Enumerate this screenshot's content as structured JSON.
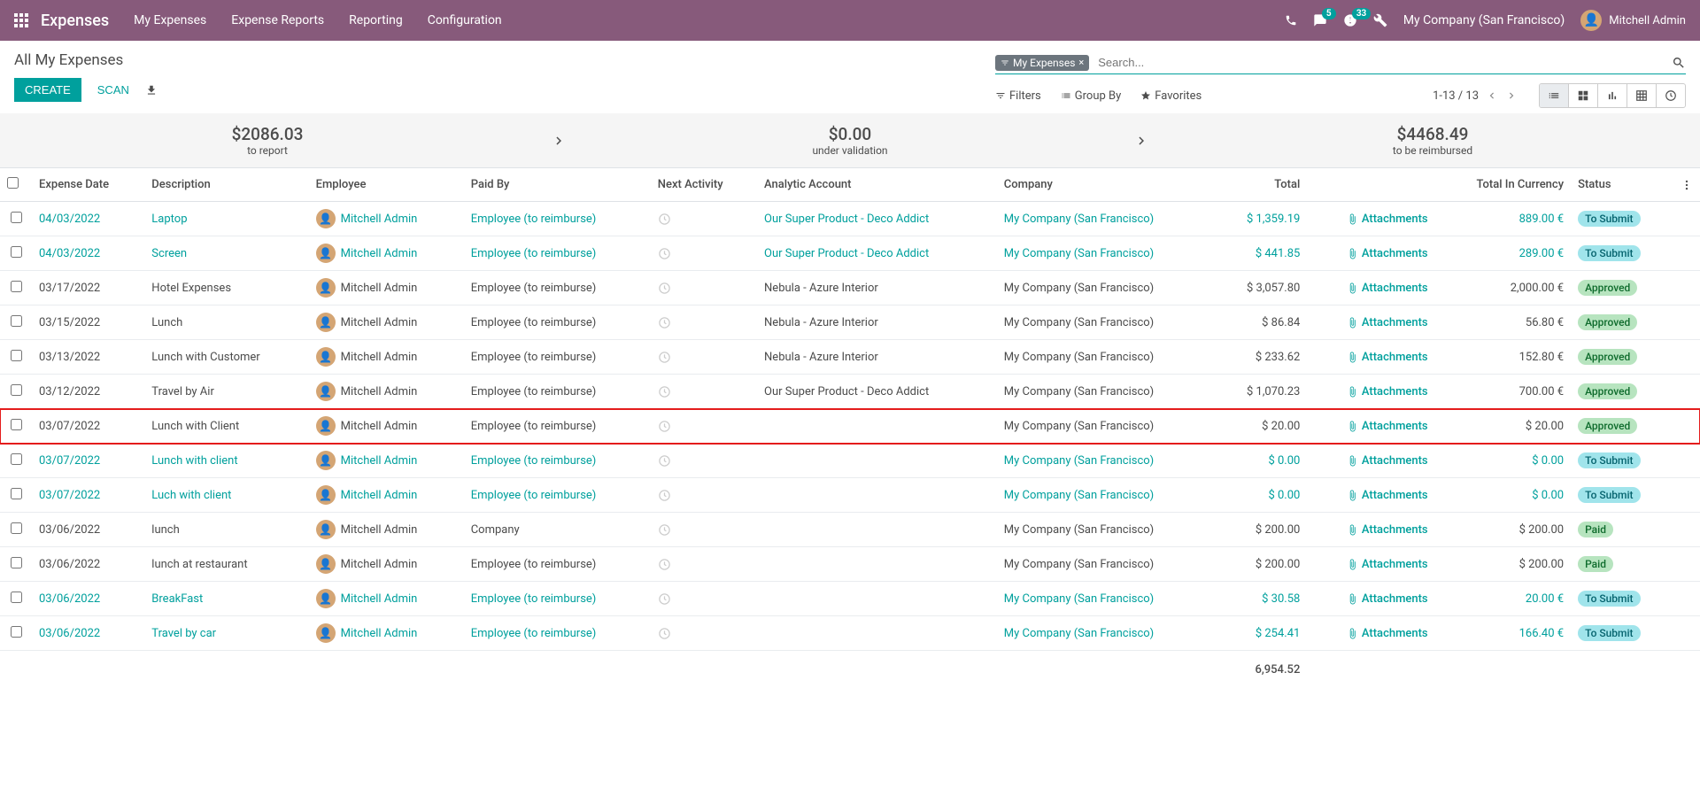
{
  "nav": {
    "brand": "Expenses",
    "items": [
      "My Expenses",
      "Expense Reports",
      "Reporting",
      "Configuration"
    ],
    "badge_chat": "5",
    "badge_activity": "33",
    "company": "My Company (San Francisco)",
    "user": "Mitchell Admin"
  },
  "page": {
    "title": "All My Expenses",
    "btn_create": "CREATE",
    "btn_scan": "SCAN",
    "search_filter_tag": "My Expenses",
    "search_placeholder": "Search...",
    "filters_label": "Filters",
    "groupby_label": "Group By",
    "favorites_label": "Favorites",
    "pager": "1-13 / 13"
  },
  "summary": {
    "to_report_amount": "$2086.03",
    "to_report_label": "to report",
    "under_validation_amount": "$0.00",
    "under_validation_label": "under validation",
    "reimbursed_amount": "$4468.49",
    "reimbursed_label": "to be reimbursed"
  },
  "table": {
    "headers": {
      "date": "Expense Date",
      "description": "Description",
      "employee": "Employee",
      "paid_by": "Paid By",
      "next_activity": "Next Activity",
      "analytic": "Analytic Account",
      "company": "Company",
      "total": "Total",
      "total_currency": "Total In Currency",
      "status": "Status"
    },
    "attachments_label": "Attachments",
    "rows": [
      {
        "date": "04/03/2022",
        "desc": "Laptop",
        "employee": "Mitchell Admin",
        "paid_by": "Employee (to reimburse)",
        "analytic": "Our Super Product - Deco Addict",
        "company": "My Company (San Francisco)",
        "total": "$ 1,359.19",
        "total_cur": "889.00 €",
        "status": "To Submit",
        "status_class": "submit",
        "link": true,
        "highlighted": false
      },
      {
        "date": "04/03/2022",
        "desc": "Screen",
        "employee": "Mitchell Admin",
        "paid_by": "Employee (to reimburse)",
        "analytic": "Our Super Product - Deco Addict",
        "company": "My Company (San Francisco)",
        "total": "$ 441.85",
        "total_cur": "289.00 €",
        "status": "To Submit",
        "status_class": "submit",
        "link": true,
        "highlighted": false
      },
      {
        "date": "03/17/2022",
        "desc": "Hotel Expenses",
        "employee": "Mitchell Admin",
        "paid_by": "Employee (to reimburse)",
        "analytic": "Nebula - Azure Interior",
        "company": "My Company (San Francisco)",
        "total": "$ 3,057.80",
        "total_cur": "2,000.00 €",
        "status": "Approved",
        "status_class": "approved",
        "link": false,
        "highlighted": false
      },
      {
        "date": "03/15/2022",
        "desc": "Lunch",
        "employee": "Mitchell Admin",
        "paid_by": "Employee (to reimburse)",
        "analytic": "Nebula - Azure Interior",
        "company": "My Company (San Francisco)",
        "total": "$ 86.84",
        "total_cur": "56.80 €",
        "status": "Approved",
        "status_class": "approved",
        "link": false,
        "highlighted": false
      },
      {
        "date": "03/13/2022",
        "desc": "Lunch with Customer",
        "employee": "Mitchell Admin",
        "paid_by": "Employee (to reimburse)",
        "analytic": "Nebula - Azure Interior",
        "company": "My Company (San Francisco)",
        "total": "$ 233.62",
        "total_cur": "152.80 €",
        "status": "Approved",
        "status_class": "approved",
        "link": false,
        "highlighted": false
      },
      {
        "date": "03/12/2022",
        "desc": "Travel by Air",
        "employee": "Mitchell Admin",
        "paid_by": "Employee (to reimburse)",
        "analytic": "Our Super Product - Deco Addict",
        "company": "My Company (San Francisco)",
        "total": "$ 1,070.23",
        "total_cur": "700.00 €",
        "status": "Approved",
        "status_class": "approved",
        "link": false,
        "highlighted": false
      },
      {
        "date": "03/07/2022",
        "desc": "Lunch with Client",
        "employee": "Mitchell Admin",
        "paid_by": "Employee (to reimburse)",
        "analytic": "",
        "company": "My Company (San Francisco)",
        "total": "$ 20.00",
        "total_cur": "$ 20.00",
        "status": "Approved",
        "status_class": "approved",
        "link": false,
        "highlighted": true
      },
      {
        "date": "03/07/2022",
        "desc": "Lunch with client",
        "employee": "Mitchell Admin",
        "paid_by": "Employee (to reimburse)",
        "analytic": "",
        "company": "My Company (San Francisco)",
        "total": "$ 0.00",
        "total_cur": "$ 0.00",
        "status": "To Submit",
        "status_class": "submit",
        "link": true,
        "highlighted": false
      },
      {
        "date": "03/07/2022",
        "desc": "Luch with client",
        "employee": "Mitchell Admin",
        "paid_by": "Employee (to reimburse)",
        "analytic": "",
        "company": "My Company (San Francisco)",
        "total": "$ 0.00",
        "total_cur": "$ 0.00",
        "status": "To Submit",
        "status_class": "submit",
        "link": true,
        "highlighted": false
      },
      {
        "date": "03/06/2022",
        "desc": "lunch",
        "employee": "Mitchell Admin",
        "paid_by": "Company",
        "analytic": "",
        "company": "My Company (San Francisco)",
        "total": "$ 200.00",
        "total_cur": "$ 200.00",
        "status": "Paid",
        "status_class": "paid",
        "link": false,
        "highlighted": false
      },
      {
        "date": "03/06/2022",
        "desc": "lunch at restaurant",
        "employee": "Mitchell Admin",
        "paid_by": "Employee (to reimburse)",
        "analytic": "",
        "company": "My Company (San Francisco)",
        "total": "$ 200.00",
        "total_cur": "$ 200.00",
        "status": "Paid",
        "status_class": "paid",
        "link": false,
        "highlighted": false
      },
      {
        "date": "03/06/2022",
        "desc": "BreakFast",
        "employee": "Mitchell Admin",
        "paid_by": "Employee (to reimburse)",
        "analytic": "",
        "company": "My Company (San Francisco)",
        "total": "$ 30.58",
        "total_cur": "20.00 €",
        "status": "To Submit",
        "status_class": "submit",
        "link": true,
        "highlighted": false
      },
      {
        "date": "03/06/2022",
        "desc": "Travel by car",
        "employee": "Mitchell Admin",
        "paid_by": "Employee (to reimburse)",
        "analytic": "",
        "company": "My Company (San Francisco)",
        "total": "$ 254.41",
        "total_cur": "166.40 €",
        "status": "To Submit",
        "status_class": "submit",
        "link": true,
        "highlighted": false
      }
    ],
    "footer_total": "6,954.52"
  }
}
